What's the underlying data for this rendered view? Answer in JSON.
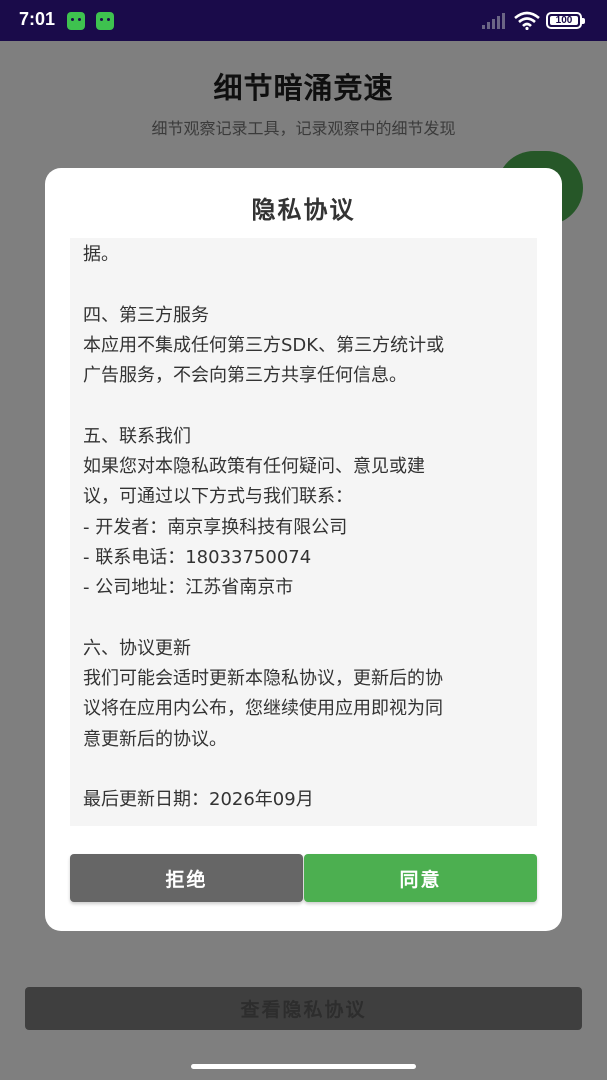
{
  "status_bar": {
    "time": "7:01",
    "battery": "100",
    "icons": [
      "android-notification-icon",
      "android-notification-icon",
      "signal-icon",
      "wifi-icon",
      "battery-icon"
    ]
  },
  "app": {
    "title": "细节暗涌竞速",
    "subtitle": "细节观察记录工具，记录观察中的细节发现",
    "bottom_button": "查看隐私协议"
  },
  "dialog": {
    "title": "隐私协议",
    "lines": [
      "据。",
      "",
      "四、第三方服务",
      "本应用不集成任何第三方SDK、第三方统计或",
      "广告服务，不会向第三方共享任何信息。",
      "",
      "五、联系我们",
      "如果您对本隐私政策有任何疑问、意见或建",
      "议，可通过以下方式与我们联系：",
      "- 开发者：南京享换科技有限公司",
      "- 联系电话：18033750074",
      "- 公司地址：江苏省南京市",
      "",
      "六、协议更新",
      "我们可能会适时更新本隐私协议，更新后的协",
      "议将在应用内公布，您继续使用应用即视为同",
      "意更新后的协议。",
      "",
      "最后更新日期：2026年09月"
    ],
    "reject_label": "拒绝",
    "agree_label": "同意"
  },
  "colors": {
    "status_bar_bg": "#1a0b4a",
    "accent_green": "#4caf50",
    "reject_gray": "#666666"
  }
}
